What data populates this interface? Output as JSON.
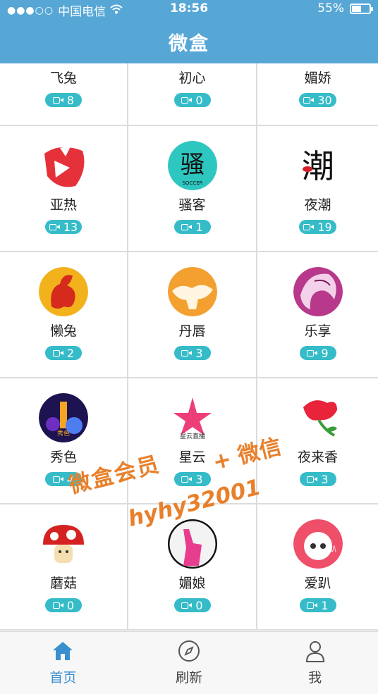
{
  "status_bar": {
    "signal": "●●●○○",
    "carrier": "中国电信",
    "time": "18:56",
    "battery_percent": "55%",
    "battery_level": 0.55
  },
  "nav": {
    "title": "微盒"
  },
  "grid": [
    {
      "name": "飞兔",
      "count": "8"
    },
    {
      "name": "初心",
      "count": "0"
    },
    {
      "name": "媚娇",
      "count": "30"
    },
    {
      "name": "亚热",
      "count": "13",
      "logo_text": ""
    },
    {
      "name": "骚客",
      "count": "1",
      "logo_text": "骚",
      "logo_sub": "SOCCER"
    },
    {
      "name": "夜潮",
      "count": "19",
      "logo_text": "潮"
    },
    {
      "name": "懒兔",
      "count": "2"
    },
    {
      "name": "丹唇",
      "count": "3"
    },
    {
      "name": "乐享",
      "count": "9"
    },
    {
      "name": "秀色",
      "count": "4",
      "logo_text": "秀色"
    },
    {
      "name": "星云",
      "count": "3",
      "logo_text": "星云直播"
    },
    {
      "name": "夜来香",
      "count": "3"
    },
    {
      "name": "蘑菇",
      "count": "0"
    },
    {
      "name": "媚娘",
      "count": "0"
    },
    {
      "name": "爱趴",
      "count": "1",
      "logo_text": "趴"
    }
  ],
  "watermark": {
    "line1": "微盒会员",
    "line2": "+ 微信",
    "line3": "hyhy32001"
  },
  "tabbar": [
    {
      "label": "首页",
      "icon": "home-icon",
      "active": true
    },
    {
      "label": "刷新",
      "icon": "compass-icon",
      "active": false
    },
    {
      "label": "我",
      "icon": "user-icon",
      "active": false
    }
  ],
  "colors": {
    "header": "#57a7d6",
    "badge": "#35bcc8",
    "active_tab": "#3a8fcf",
    "watermark": "#e8802b"
  }
}
